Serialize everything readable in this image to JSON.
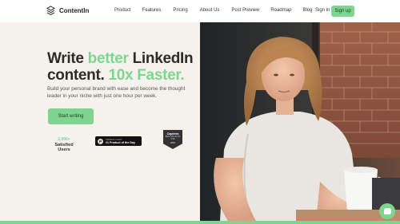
{
  "nav": {
    "brand": "ContentIn",
    "items": [
      "Product",
      "Features",
      "Pricing",
      "About Us",
      "Post Preview",
      "Roadmap",
      "Blog"
    ],
    "signin": "Sign in",
    "signup": "Sign up"
  },
  "hero": {
    "headline_1": "Write ",
    "headline_accent_1": "better",
    "headline_2": " LinkedIn content. ",
    "headline_accent_2": "10x Faster.",
    "subtext": "Build your personal brand with ease and become the thought leader in your niche with just one hour per week.",
    "cta": "Start writing"
  },
  "stats": {
    "users_count": "2,000+",
    "users_label": "Satisfied Users"
  },
  "producthunt": {
    "small": "PRODUCT HUNT",
    "main": "#1 Product of the Day"
  },
  "capterra": {
    "logo": "Capterra",
    "text": "BEST VALUE OF USE",
    "year": "2023"
  },
  "colors": {
    "accent": "#7ed58f",
    "bg": "#f5f1ec"
  }
}
